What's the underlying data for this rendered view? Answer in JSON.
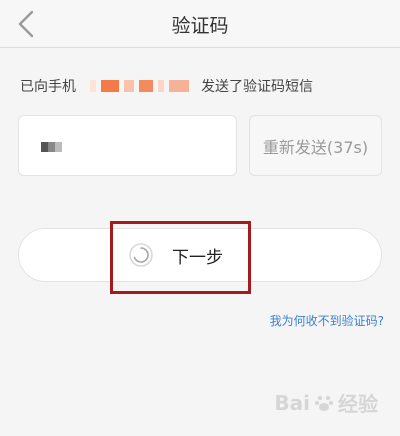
{
  "nav": {
    "title": "验证码"
  },
  "sms_notice": {
    "prefix": "已向手机",
    "suffix": "发送了验证码短信"
  },
  "code_input": {
    "value_masked": true
  },
  "resend": {
    "label": "重新发送(37s)"
  },
  "next": {
    "label": "下一步"
  },
  "help": {
    "link": "我为何收不到验证码?"
  },
  "watermark": {
    "text": "Bai",
    "text2": "经验"
  },
  "colors": {
    "link": "#3a7fd5",
    "highlight": "#a31b1f",
    "mask_orange": "#f58a5c",
    "mask_light": "#f9c2ab"
  }
}
